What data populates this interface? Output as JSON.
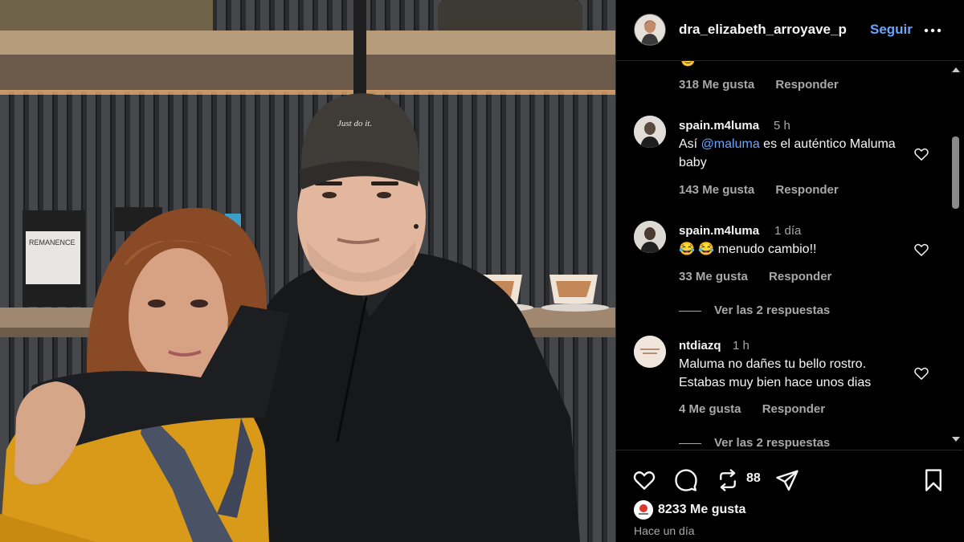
{
  "post": {
    "username": "dra_elizabeth_arroyave_p",
    "follow_label": "Seguir",
    "photo": {
      "cap_text": "Just do it.",
      "coffee_bag_label": "REMANENCE"
    }
  },
  "comments": {
    "first_meta": {
      "likes": "318 Me gusta",
      "reply": "Responder"
    },
    "items": [
      {
        "user": "spain.m4luma",
        "time": "5 h",
        "text_before": "Así ",
        "mention": "@maluma",
        "text_after": " es el auténtico Maluma baby",
        "likes": "143 Me gusta",
        "reply": "Responder"
      },
      {
        "user": "spain.m4luma",
        "time": "1 día",
        "text": "😂 😂 menudo cambio!!",
        "likes": "33 Me gusta",
        "reply": "Responder",
        "view_replies": "Ver las 2 respuestas"
      },
      {
        "user": "ntdiazq",
        "time": "1 h",
        "text": "Maluma no dañes tu bello rostro. Estabas muy bien hace unos dias",
        "likes": "4 Me gusta",
        "reply": "Responder",
        "view_replies": "Ver las 2 respuestas"
      }
    ]
  },
  "actions": {
    "icons": [
      "heart-icon",
      "comment-icon",
      "repost-icon",
      "share-icon",
      "bookmark-icon"
    ],
    "repost_count": "88",
    "likes_total": "8233 Me gusta",
    "timestamp": "Hace un día"
  },
  "colors": {
    "background": "#000000",
    "text": "#f5f5f5",
    "secondary_text": "#a8a8a8",
    "link": "#6aa5ff"
  }
}
